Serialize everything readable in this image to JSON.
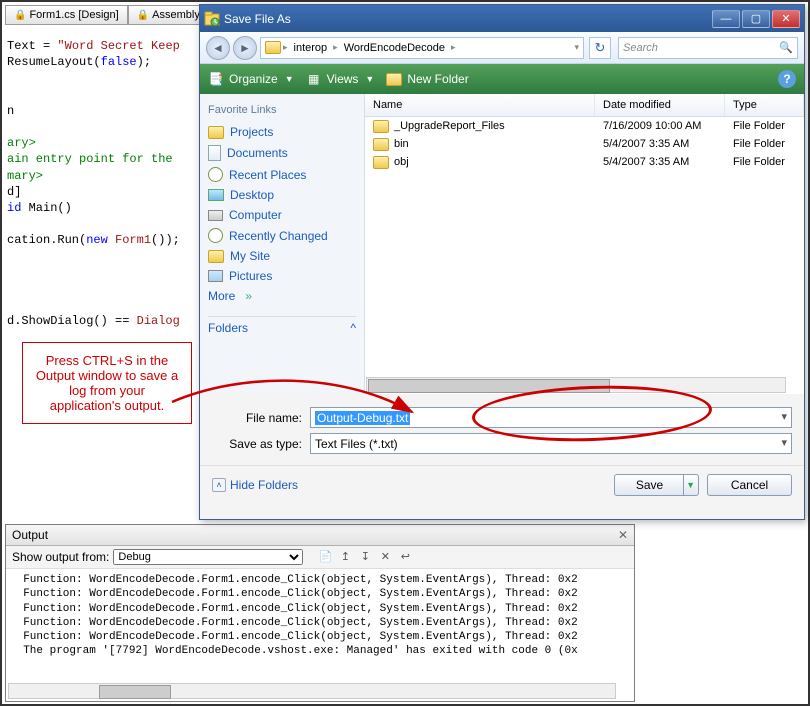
{
  "tabs": [
    {
      "label": "Form1.cs [Design]"
    },
    {
      "label": "Assembly..."
    }
  ],
  "code": {
    "l1a": "Text = ",
    "l1b": "\"Word Secret Keep",
    "l2a": "ResumeLayout(",
    "l2b": "false",
    "l2c": ");",
    "l3": "n",
    "l4": "ary>",
    "l5": "ain entry point for the ",
    "l6": "mary>",
    "l7": "d]",
    "l8a": "id",
    "l8b": " Main()",
    "l9a": "cation.Run(",
    "l9b": "new",
    "l9c": " Form1",
    "l9d": "());",
    "l10a": "d.ShowDialog() == ",
    "l10b": "Dialog"
  },
  "annotation": "Press CTRL+S in the Output window to save a log from your application's output.",
  "output": {
    "title": "Output",
    "show_from_label": "Show output from:",
    "show_from_value": "Debug",
    "lines": [
      "  Function: WordEncodeDecode.Form1.encode_Click(object, System.EventArgs), Thread: 0x2",
      "  Function: WordEncodeDecode.Form1.encode_Click(object, System.EventArgs), Thread: 0x2",
      "  Function: WordEncodeDecode.Form1.encode_Click(object, System.EventArgs), Thread: 0x2",
      "  Function: WordEncodeDecode.Form1.encode_Click(object, System.EventArgs), Thread: 0x2",
      "  Function: WordEncodeDecode.Form1.encode_Click(object, System.EventArgs), Thread: 0x2",
      "  The program '[7792] WordEncodeDecode.vshost.exe: Managed' has exited with code 0 (0x"
    ]
  },
  "dialog": {
    "title": "Save File As",
    "breadcrumb": [
      "interop",
      "WordEncodeDecode"
    ],
    "search_placeholder": "Search",
    "cmdbar": {
      "organize": "Organize",
      "views": "Views",
      "newfolder": "New Folder"
    },
    "fav_title": "Favorite Links",
    "fav_links": [
      {
        "icon": "folder",
        "label": "Projects"
      },
      {
        "icon": "doc",
        "label": "Documents"
      },
      {
        "icon": "clock",
        "label": "Recent Places"
      },
      {
        "icon": "monitor",
        "label": "Desktop"
      },
      {
        "icon": "drive",
        "label": "Computer"
      },
      {
        "icon": "clock",
        "label": "Recently Changed"
      },
      {
        "icon": "folder",
        "label": "My Site"
      },
      {
        "icon": "pic",
        "label": "Pictures"
      },
      {
        "icon": "more",
        "label": "More"
      }
    ],
    "folders_label": "Folders",
    "columns": {
      "name": "Name",
      "date": "Date modified",
      "type": "Type"
    },
    "rows": [
      {
        "name": "_UpgradeReport_Files",
        "date": "7/16/2009 10:00 AM",
        "type": "File Folder"
      },
      {
        "name": "bin",
        "date": "5/4/2007 3:35 AM",
        "type": "File Folder"
      },
      {
        "name": "obj",
        "date": "5/4/2007 3:35 AM",
        "type": "File Folder"
      }
    ],
    "filename_label": "File name:",
    "filename_value": "Output-Debug.txt",
    "saveas_label": "Save as type:",
    "saveas_value": "Text Files (*.txt)",
    "hide_folders": "Hide Folders",
    "save": "Save",
    "cancel": "Cancel"
  }
}
